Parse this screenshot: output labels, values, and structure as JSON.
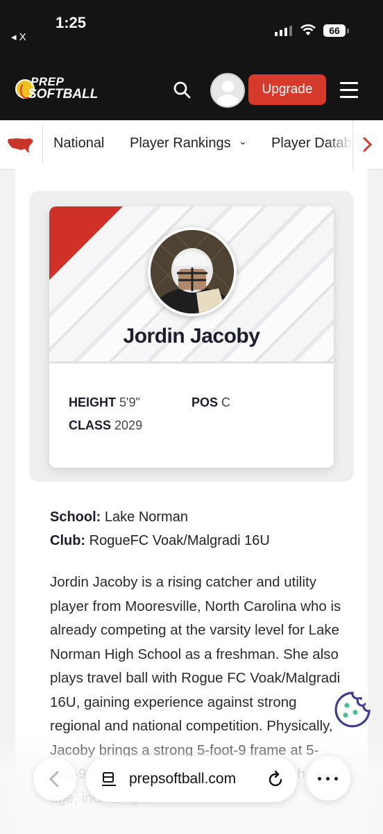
{
  "status_bar": {
    "time": "1:25",
    "back_app": "◂ X",
    "battery": "66"
  },
  "header": {
    "logo_line1": "PREP",
    "logo_line2": "SOFTBALL",
    "upgrade_label": "Upgrade"
  },
  "nav": {
    "items": [
      "National",
      "Player Rankings",
      "Player Datab"
    ],
    "dropdown_chevron": "⌄"
  },
  "player": {
    "name": "Jordin Jacoby",
    "height_label": "HEIGHT",
    "height_value": "5'9\"",
    "pos_label": "POS",
    "pos_value": "C",
    "class_label": "CLASS",
    "class_value": "2029"
  },
  "info": {
    "school_label": "School:",
    "school_value": "Lake Norman",
    "club_label": "Club:",
    "club_value": "RogueFC Voak/Malgradi 16U"
  },
  "bio": "Jordin Jacoby is a rising catcher and utility player from Mooresville, North Carolina who is already competing at the varsity level for Lake Norman High School as a freshman. She also plays travel ball with Rogue FC Voak/Malgradi 16U, gaining experience against strong regional and national competition. Physically, Jacoby brings a strong 5-foot-9 frame at 5-foot-9 with standout defensive tools for her age, including a",
  "browser": {
    "url": "prepsoftball.com"
  },
  "colors": {
    "brand_red": "#d53a2a",
    "header_bg": "#141414",
    "cookie_color": "#3d3f8a"
  },
  "icons": {
    "search": "search-icon",
    "menu": "hamburger-menu-icon",
    "reload": "reload-icon",
    "cookie": "cookie-icon"
  }
}
